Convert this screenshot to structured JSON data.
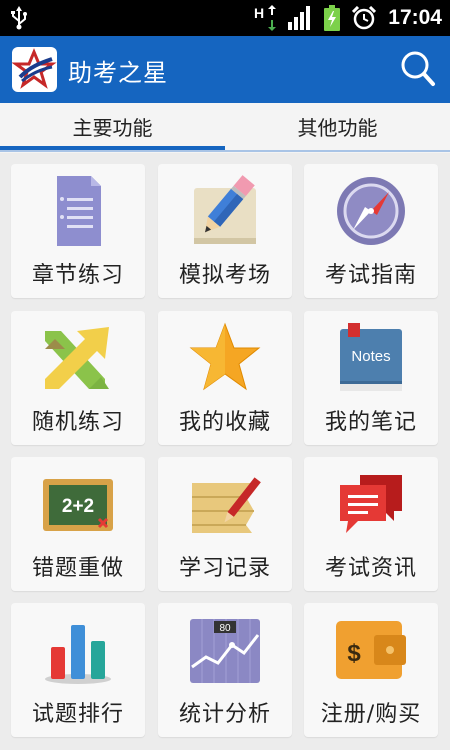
{
  "status_bar": {
    "time": "17:04"
  },
  "app_bar": {
    "title": "助考之星"
  },
  "tabs": [
    {
      "label": "主要功能"
    },
    {
      "label": "其他功能"
    }
  ],
  "grid": [
    {
      "label": "章节练习",
      "icon": "chapter-doc-icon"
    },
    {
      "label": "模拟考场",
      "icon": "pencil-paper-icon"
    },
    {
      "label": "考试指南",
      "icon": "compass-icon"
    },
    {
      "label": "随机练习",
      "icon": "shuffle-arrows-icon"
    },
    {
      "label": "我的收藏",
      "icon": "star-icon"
    },
    {
      "label": "我的笔记",
      "icon": "notes-book-icon",
      "icon_text": "Notes"
    },
    {
      "label": "错题重做",
      "icon": "chalkboard-icon",
      "icon_text": "2+2"
    },
    {
      "label": "学习记录",
      "icon": "record-paper-icon"
    },
    {
      "label": "考试资讯",
      "icon": "chat-bubbles-icon"
    },
    {
      "label": "试题排行",
      "icon": "bar-chart-icon"
    },
    {
      "label": "统计分析",
      "icon": "line-chart-icon",
      "icon_text": "80"
    },
    {
      "label": "注册/购买",
      "icon": "wallet-icon",
      "icon_text": "$"
    }
  ],
  "colors": {
    "primary": "#1565c0",
    "background": "#ececec",
    "tile": "#f8f8f8"
  }
}
